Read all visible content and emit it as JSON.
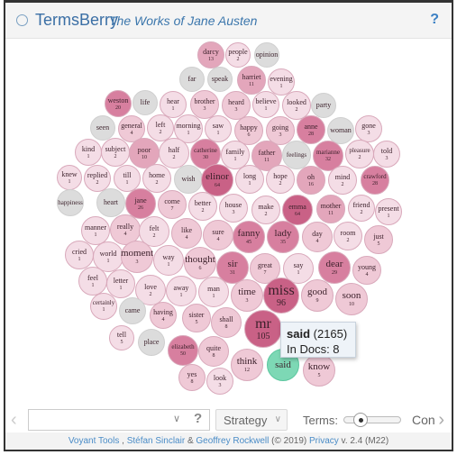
{
  "header": {
    "app_title": "TermsBerry",
    "corpus_title": "The Works of Jane Austen",
    "help_label": "?"
  },
  "colors": {
    "grey": "#dcdcdc",
    "light": "#f4dde6",
    "mid1": "#efc9d6",
    "mid2": "#e3a6bb",
    "dark": "#d77f9f",
    "darker": "#c96186",
    "highlight": "#7dd8b5"
  },
  "bubbles": [
    {
      "word": "darcy",
      "count": "13",
      "tone": "mid2"
    },
    {
      "word": "people",
      "count": "2",
      "tone": "light"
    },
    {
      "word": "opinion",
      "count": "",
      "tone": "grey"
    },
    {
      "word": "far",
      "count": "",
      "tone": "grey"
    },
    {
      "word": "speak",
      "count": "",
      "tone": "grey"
    },
    {
      "word": "harriet",
      "count": "11",
      "tone": "mid2"
    },
    {
      "word": "evening",
      "count": "1",
      "tone": "light"
    },
    {
      "word": "weston",
      "count": "20",
      "tone": "dark"
    },
    {
      "word": "life",
      "count": "",
      "tone": "grey"
    },
    {
      "word": "hear",
      "count": "1",
      "tone": "light"
    },
    {
      "word": "brother",
      "count": "3",
      "tone": "mid1"
    },
    {
      "word": "heard",
      "count": "3",
      "tone": "mid1"
    },
    {
      "word": "believe",
      "count": "1",
      "tone": "light"
    },
    {
      "word": "looked",
      "count": "2",
      "tone": "light"
    },
    {
      "word": "party",
      "count": "",
      "tone": "grey"
    },
    {
      "word": "seen",
      "count": "",
      "tone": "grey"
    },
    {
      "word": "general",
      "count": "4",
      "tone": "mid1"
    },
    {
      "word": "left",
      "count": "2",
      "tone": "light"
    },
    {
      "word": "morning",
      "count": "1",
      "tone": "light"
    },
    {
      "word": "saw",
      "count": "1",
      "tone": "light"
    },
    {
      "word": "happy",
      "count": "6",
      "tone": "mid1"
    },
    {
      "word": "going",
      "count": "3",
      "tone": "mid1"
    },
    {
      "word": "anne",
      "count": "28",
      "tone": "dark"
    },
    {
      "word": "woman",
      "count": "",
      "tone": "grey"
    },
    {
      "word": "gone",
      "count": "3",
      "tone": "light"
    },
    {
      "word": "kind",
      "count": "1",
      "tone": "light"
    },
    {
      "word": "subject",
      "count": "2",
      "tone": "light"
    },
    {
      "word": "poor",
      "count": "10",
      "tone": "mid2"
    },
    {
      "word": "half",
      "count": "2",
      "tone": "light"
    },
    {
      "word": "catherine",
      "count": "30",
      "tone": "dark"
    },
    {
      "word": "family",
      "count": "1",
      "tone": "light"
    },
    {
      "word": "father",
      "count": "11",
      "tone": "mid2"
    },
    {
      "word": "feelings",
      "count": "",
      "tone": "grey"
    },
    {
      "word": "marianne",
      "count": "32",
      "tone": "dark"
    },
    {
      "word": "pleasure",
      "count": "2",
      "tone": "light"
    },
    {
      "word": "told",
      "count": "3",
      "tone": "light"
    },
    {
      "word": "knew",
      "count": "1",
      "tone": "light"
    },
    {
      "word": "replied",
      "count": "2",
      "tone": "light"
    },
    {
      "word": "till",
      "count": "1",
      "tone": "light"
    },
    {
      "word": "home",
      "count": "2",
      "tone": "light"
    },
    {
      "word": "wish",
      "count": "",
      "tone": "grey"
    },
    {
      "word": "elinor",
      "count": "64",
      "tone": "darker"
    },
    {
      "word": "long",
      "count": "1",
      "tone": "light"
    },
    {
      "word": "hope",
      "count": "2",
      "tone": "light"
    },
    {
      "word": "oh",
      "count": "16",
      "tone": "mid2"
    },
    {
      "word": "mind",
      "count": "2",
      "tone": "light"
    },
    {
      "word": "crawford",
      "count": "28",
      "tone": "dark"
    },
    {
      "word": "happiness",
      "count": "",
      "tone": "grey"
    },
    {
      "word": "heart",
      "count": "",
      "tone": "grey"
    },
    {
      "word": "jane",
      "count": "26",
      "tone": "dark"
    },
    {
      "word": "come",
      "count": "7",
      "tone": "mid1"
    },
    {
      "word": "better",
      "count": "2",
      "tone": "light"
    },
    {
      "word": "house",
      "count": "3",
      "tone": "light"
    },
    {
      "word": "make",
      "count": "2",
      "tone": "light"
    },
    {
      "word": "emma",
      "count": "64",
      "tone": "darker"
    },
    {
      "word": "mother",
      "count": "11",
      "tone": "mid2"
    },
    {
      "word": "friend",
      "count": "2",
      "tone": "light"
    },
    {
      "word": "present",
      "count": "1",
      "tone": "light"
    },
    {
      "word": "manner",
      "count": "1",
      "tone": "light"
    },
    {
      "word": "really",
      "count": "4",
      "tone": "mid1"
    },
    {
      "word": "felt",
      "count": "2",
      "tone": "light"
    },
    {
      "word": "like",
      "count": "4",
      "tone": "mid1"
    },
    {
      "word": "sure",
      "count": "4",
      "tone": "mid1"
    },
    {
      "word": "fanny",
      "count": "45",
      "tone": "dark"
    },
    {
      "word": "lady",
      "count": "35",
      "tone": "dark"
    },
    {
      "word": "day",
      "count": "4",
      "tone": "mid1"
    },
    {
      "word": "room",
      "count": "2",
      "tone": "light"
    },
    {
      "word": "just",
      "count": "5",
      "tone": "mid1"
    },
    {
      "word": "cried",
      "count": "1",
      "tone": "light"
    },
    {
      "word": "world",
      "count": "1",
      "tone": "light"
    },
    {
      "word": "moment",
      "count": "3",
      "tone": "mid1"
    },
    {
      "word": "way",
      "count": "1",
      "tone": "light"
    },
    {
      "word": "thought",
      "count": "6",
      "tone": "mid1"
    },
    {
      "word": "sir",
      "count": "31",
      "tone": "dark"
    },
    {
      "word": "great",
      "count": "7",
      "tone": "mid1"
    },
    {
      "word": "say",
      "count": "1",
      "tone": "light"
    },
    {
      "word": "dear",
      "count": "29",
      "tone": "dark"
    },
    {
      "word": "young",
      "count": "4",
      "tone": "mid1"
    },
    {
      "word": "feel",
      "count": "1",
      "tone": "light"
    },
    {
      "word": "letter",
      "count": "1",
      "tone": "light"
    },
    {
      "word": "love",
      "count": "2",
      "tone": "light"
    },
    {
      "word": "away",
      "count": "1",
      "tone": "light"
    },
    {
      "word": "man",
      "count": "1",
      "tone": "light"
    },
    {
      "word": "time",
      "count": "3",
      "tone": "mid1"
    },
    {
      "word": "miss",
      "count": "96",
      "tone": "darker"
    },
    {
      "word": "good",
      "count": "9",
      "tone": "mid1"
    },
    {
      "word": "soon",
      "count": "10",
      "tone": "mid1"
    },
    {
      "word": "certainly",
      "count": "1",
      "tone": "light"
    },
    {
      "word": "came",
      "count": "",
      "tone": "grey"
    },
    {
      "word": "having",
      "count": "4",
      "tone": "mid1"
    },
    {
      "word": "sister",
      "count": "5",
      "tone": "mid1"
    },
    {
      "word": "shall",
      "count": "8",
      "tone": "mid1"
    },
    {
      "word": "mr",
      "count": "105",
      "tone": "darker"
    },
    {
      "word": "tell",
      "count": "5",
      "tone": "light"
    },
    {
      "word": "place",
      "count": "",
      "tone": "grey"
    },
    {
      "word": "elizabeth",
      "count": "50",
      "tone": "dark"
    },
    {
      "word": "quite",
      "count": "8",
      "tone": "mid1"
    },
    {
      "word": "think",
      "count": "12",
      "tone": "mid1"
    },
    {
      "word": "said",
      "count": "",
      "tone": "highlight"
    },
    {
      "word": "know",
      "count": "5",
      "tone": "mid1"
    },
    {
      "word": "yes",
      "count": "8",
      "tone": "mid1"
    },
    {
      "word": "look",
      "count": "3",
      "tone": "light"
    }
  ],
  "tooltip": {
    "term": "said",
    "freq": "(2165)",
    "docs": "In Docs: 8"
  },
  "toolbar": {
    "search_value": "",
    "search_placeholder": "",
    "search_help": "?",
    "strategy_label": "Strategy",
    "terms_label": "Terms:",
    "terms_slider_fraction": 0.2,
    "con_label": "Con"
  },
  "footer": {
    "voyant_link": "Voyant Tools",
    "sep1": " , ",
    "author1": "Stéfan Sinclair",
    "amp": " & ",
    "author2": "Geoffrey Rockwell",
    "copyright": " (© 2019) ",
    "privacy_link": "Privacy",
    "version": " v. 2.4 (M22)"
  }
}
